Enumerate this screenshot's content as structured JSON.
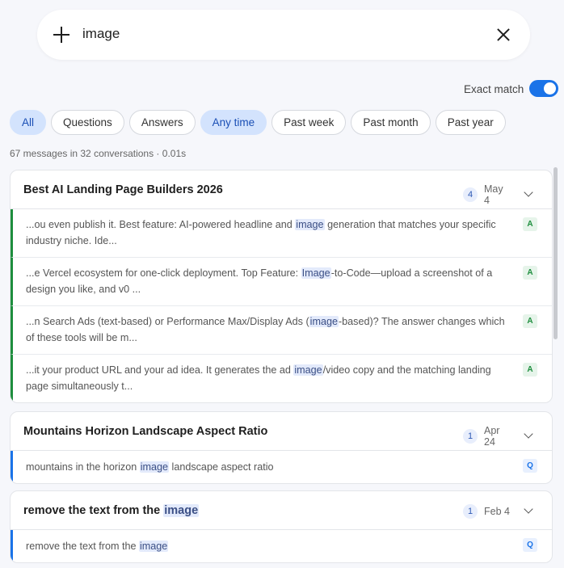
{
  "search": {
    "query": "image"
  },
  "exact_match": {
    "label": "Exact match",
    "enabled": true
  },
  "filters": {
    "type_chips": [
      {
        "label": "All",
        "active": true
      },
      {
        "label": "Questions",
        "active": false
      },
      {
        "label": "Answers",
        "active": false
      }
    ],
    "time_chips": [
      {
        "label": "Any time",
        "active": true
      },
      {
        "label": "Past week",
        "active": false
      },
      {
        "label": "Past month",
        "active": false
      },
      {
        "label": "Past year",
        "active": false
      }
    ]
  },
  "stats": "67 messages in 32 conversations · 0.01s",
  "conversations": [
    {
      "title": "Best AI Landing Page Builders 2026",
      "count": "4",
      "date": "May 4",
      "results": [
        {
          "role": "A",
          "before": "...ou even publish it. Best feature: AI-powered headline and ",
          "match": "image",
          "after": " generation that matches your specific industry niche. Ide..."
        },
        {
          "role": "A",
          "before": "...e Vercel ecosystem for one-click deployment. Top Feature: ",
          "match": "Image",
          "after": "-to-Code—upload a screenshot of a design you like, and v0 ..."
        },
        {
          "role": "A",
          "before": "...n Search Ads (text-based) or Performance Max/Display Ads (",
          "match": "image",
          "after": "-based)? The answer changes which of these tools will be m..."
        },
        {
          "role": "A",
          "before": "...it your product URL and your ad idea. It generates the ad ",
          "match": "image",
          "after": "/video copy and the matching landing page simultaneously t..."
        }
      ]
    },
    {
      "title": "Mountains Horizon Landscape Aspect Ratio",
      "count": "1",
      "date": "Apr 24",
      "results": [
        {
          "role": "Q",
          "before": "mountains in the horizon ",
          "match": "image",
          "after": " landscape aspect ratio"
        }
      ]
    },
    {
      "title_before": "remove the text from the ",
      "title_match": "image",
      "count": "1",
      "date": "Feb 4",
      "results": [
        {
          "role": "Q",
          "before": "remove the text from the ",
          "match": "image",
          "after": ""
        }
      ]
    }
  ]
}
